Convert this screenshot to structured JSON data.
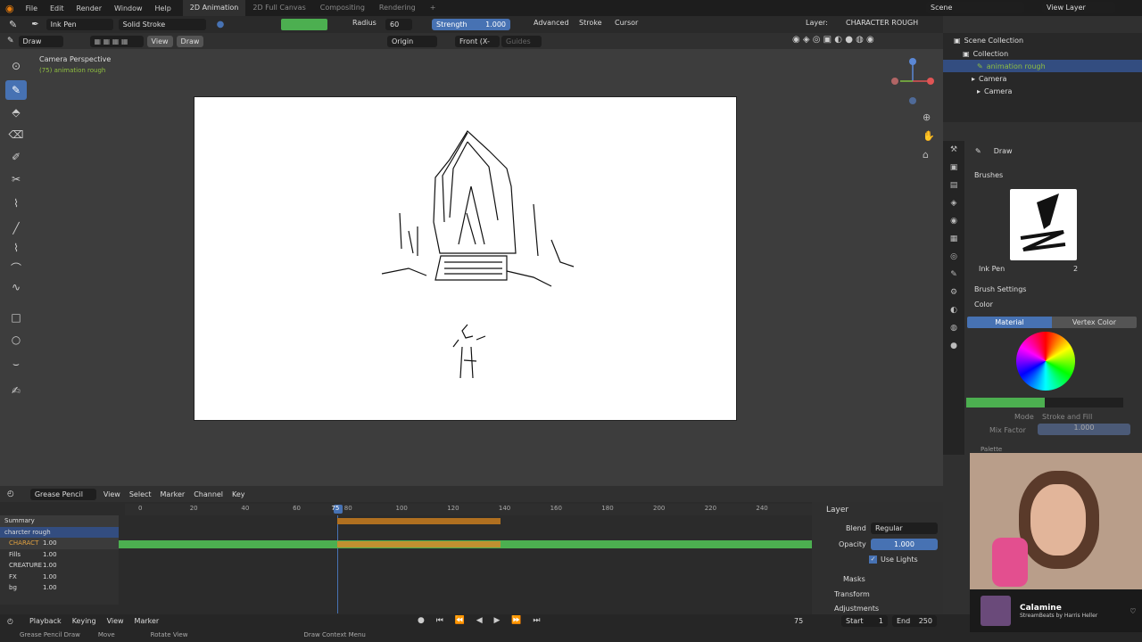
{
  "menu": {
    "file": "File",
    "edit": "Edit",
    "render": "Render",
    "window": "Window",
    "help": "Help",
    "workspaces": [
      "2D Animation",
      "2D Full Canvas",
      "Compositing",
      "Rendering"
    ],
    "add_tab": "+",
    "scene": "Scene",
    "view_layer": "View Layer"
  },
  "tool": {
    "brush_name": "Ink Pen",
    "stroke": "Solid Stroke",
    "radius_label": "Radius",
    "radius_value": "60 px",
    "strength_label": "Strength",
    "strength_value": "1.000",
    "advanced": "Advanced",
    "stroke_menu": "Stroke",
    "cursor": "Cursor",
    "layer_label": "Layer:",
    "layer_value": "CHARACTER ROUGH",
    "mode": "Draw",
    "view": "View",
    "draw": "Draw",
    "origin": "Origin",
    "front": "Front (X-Z)",
    "guides": "Guides",
    "color": "#4caf50"
  },
  "viewport": {
    "camera_label": "Camera Perspective",
    "sub_label": "(75) animation rough"
  },
  "outliner": {
    "scene_collection": "Scene Collection",
    "collection": "Collection",
    "animation_rough": "animation rough",
    "camera": "Camera",
    "camera_data": "Camera"
  },
  "props": {
    "draw": "Draw",
    "brushes": "Brushes",
    "brush_name": "Ink Pen",
    "brush_users": "2",
    "brush_settings": "Brush Settings",
    "color": "Color",
    "material_tab": "Material",
    "vertex_tab": "Vertex Color",
    "mode_label": "Mode",
    "mode_value": "Stroke and Fill",
    "mix_label": "Mix Factor",
    "mix_value": "1.000",
    "palette": "Palette",
    "swatch": "#4caf50"
  },
  "timeline": {
    "mode": "Grease Pencil",
    "view": "View",
    "select": "Select",
    "marker": "Marker",
    "channel": "Channel",
    "key": "Key",
    "ticks": [
      "0",
      "20",
      "40",
      "60",
      "75",
      "80",
      "100",
      "120",
      "140",
      "160",
      "180",
      "200",
      "220",
      "240"
    ],
    "current_frame": "75",
    "summary": "Summary",
    "object": "charcter rough",
    "layers": [
      {
        "name": "CHARACT",
        "value": "1.00"
      },
      {
        "name": "Fills",
        "value": "1.00"
      },
      {
        "name": "CREATURE",
        "value": "1.00"
      },
      {
        "name": "FX",
        "value": "1.00"
      },
      {
        "name": "bg",
        "value": "1.00"
      }
    ]
  },
  "layer_panel": {
    "title": "Layer",
    "blend_label": "Blend",
    "blend_value": "Regular",
    "opacity_label": "Opacity",
    "opacity_value": "1.000",
    "use_lights": "Use Lights",
    "masks": "Masks",
    "transform": "Transform",
    "adjustments": "Adjustments"
  },
  "playback": {
    "playback": "Playback",
    "keying": "Keying",
    "view": "View",
    "marker": "Marker",
    "frame": "75",
    "start_label": "Start",
    "start_value": "1",
    "end_label": "End",
    "end_value": "250"
  },
  "status": {
    "gp_draw": "Grease Pencil Draw",
    "move": "Move",
    "rotate": "Rotate View",
    "context": "Draw Context Menu"
  },
  "stream": {
    "song": "Calamine",
    "artist": "StreamBeats by Harris Heller"
  }
}
